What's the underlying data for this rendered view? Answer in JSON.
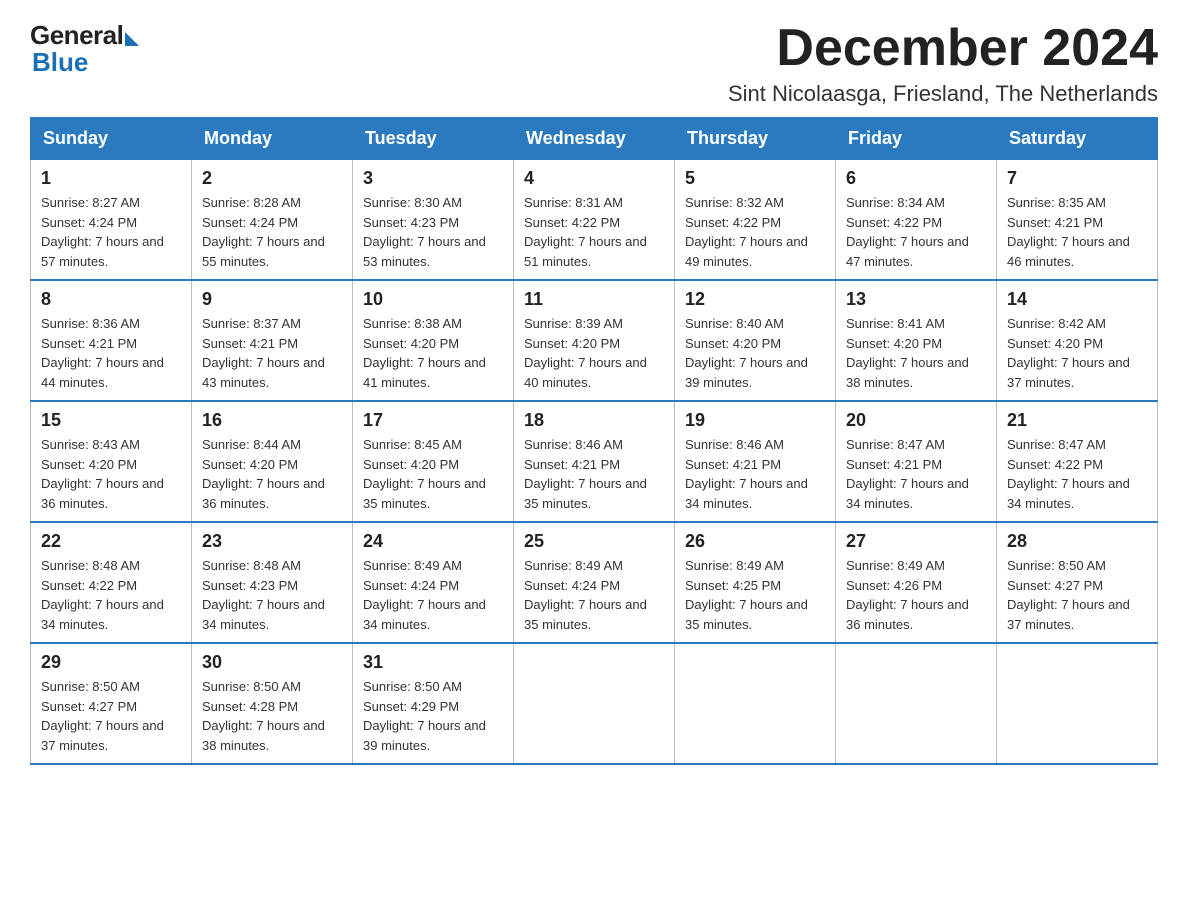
{
  "logo": {
    "general": "General",
    "blue": "Blue"
  },
  "title": "December 2024",
  "location": "Sint Nicolaasga, Friesland, The Netherlands",
  "days_of_week": [
    "Sunday",
    "Monday",
    "Tuesday",
    "Wednesday",
    "Thursday",
    "Friday",
    "Saturday"
  ],
  "weeks": [
    [
      {
        "day": "1",
        "sunrise": "8:27 AM",
        "sunset": "4:24 PM",
        "daylight": "7 hours and 57 minutes."
      },
      {
        "day": "2",
        "sunrise": "8:28 AM",
        "sunset": "4:24 PM",
        "daylight": "7 hours and 55 minutes."
      },
      {
        "day": "3",
        "sunrise": "8:30 AM",
        "sunset": "4:23 PM",
        "daylight": "7 hours and 53 minutes."
      },
      {
        "day": "4",
        "sunrise": "8:31 AM",
        "sunset": "4:22 PM",
        "daylight": "7 hours and 51 minutes."
      },
      {
        "day": "5",
        "sunrise": "8:32 AM",
        "sunset": "4:22 PM",
        "daylight": "7 hours and 49 minutes."
      },
      {
        "day": "6",
        "sunrise": "8:34 AM",
        "sunset": "4:22 PM",
        "daylight": "7 hours and 47 minutes."
      },
      {
        "day": "7",
        "sunrise": "8:35 AM",
        "sunset": "4:21 PM",
        "daylight": "7 hours and 46 minutes."
      }
    ],
    [
      {
        "day": "8",
        "sunrise": "8:36 AM",
        "sunset": "4:21 PM",
        "daylight": "7 hours and 44 minutes."
      },
      {
        "day": "9",
        "sunrise": "8:37 AM",
        "sunset": "4:21 PM",
        "daylight": "7 hours and 43 minutes."
      },
      {
        "day": "10",
        "sunrise": "8:38 AM",
        "sunset": "4:20 PM",
        "daylight": "7 hours and 41 minutes."
      },
      {
        "day": "11",
        "sunrise": "8:39 AM",
        "sunset": "4:20 PM",
        "daylight": "7 hours and 40 minutes."
      },
      {
        "day": "12",
        "sunrise": "8:40 AM",
        "sunset": "4:20 PM",
        "daylight": "7 hours and 39 minutes."
      },
      {
        "day": "13",
        "sunrise": "8:41 AM",
        "sunset": "4:20 PM",
        "daylight": "7 hours and 38 minutes."
      },
      {
        "day": "14",
        "sunrise": "8:42 AM",
        "sunset": "4:20 PM",
        "daylight": "7 hours and 37 minutes."
      }
    ],
    [
      {
        "day": "15",
        "sunrise": "8:43 AM",
        "sunset": "4:20 PM",
        "daylight": "7 hours and 36 minutes."
      },
      {
        "day": "16",
        "sunrise": "8:44 AM",
        "sunset": "4:20 PM",
        "daylight": "7 hours and 36 minutes."
      },
      {
        "day": "17",
        "sunrise": "8:45 AM",
        "sunset": "4:20 PM",
        "daylight": "7 hours and 35 minutes."
      },
      {
        "day": "18",
        "sunrise": "8:46 AM",
        "sunset": "4:21 PM",
        "daylight": "7 hours and 35 minutes."
      },
      {
        "day": "19",
        "sunrise": "8:46 AM",
        "sunset": "4:21 PM",
        "daylight": "7 hours and 34 minutes."
      },
      {
        "day": "20",
        "sunrise": "8:47 AM",
        "sunset": "4:21 PM",
        "daylight": "7 hours and 34 minutes."
      },
      {
        "day": "21",
        "sunrise": "8:47 AM",
        "sunset": "4:22 PM",
        "daylight": "7 hours and 34 minutes."
      }
    ],
    [
      {
        "day": "22",
        "sunrise": "8:48 AM",
        "sunset": "4:22 PM",
        "daylight": "7 hours and 34 minutes."
      },
      {
        "day": "23",
        "sunrise": "8:48 AM",
        "sunset": "4:23 PM",
        "daylight": "7 hours and 34 minutes."
      },
      {
        "day": "24",
        "sunrise": "8:49 AM",
        "sunset": "4:24 PM",
        "daylight": "7 hours and 34 minutes."
      },
      {
        "day": "25",
        "sunrise": "8:49 AM",
        "sunset": "4:24 PM",
        "daylight": "7 hours and 35 minutes."
      },
      {
        "day": "26",
        "sunrise": "8:49 AM",
        "sunset": "4:25 PM",
        "daylight": "7 hours and 35 minutes."
      },
      {
        "day": "27",
        "sunrise": "8:49 AM",
        "sunset": "4:26 PM",
        "daylight": "7 hours and 36 minutes."
      },
      {
        "day": "28",
        "sunrise": "8:50 AM",
        "sunset": "4:27 PM",
        "daylight": "7 hours and 37 minutes."
      }
    ],
    [
      {
        "day": "29",
        "sunrise": "8:50 AM",
        "sunset": "4:27 PM",
        "daylight": "7 hours and 37 minutes."
      },
      {
        "day": "30",
        "sunrise": "8:50 AM",
        "sunset": "4:28 PM",
        "daylight": "7 hours and 38 minutes."
      },
      {
        "day": "31",
        "sunrise": "8:50 AM",
        "sunset": "4:29 PM",
        "daylight": "7 hours and 39 minutes."
      },
      null,
      null,
      null,
      null
    ]
  ]
}
